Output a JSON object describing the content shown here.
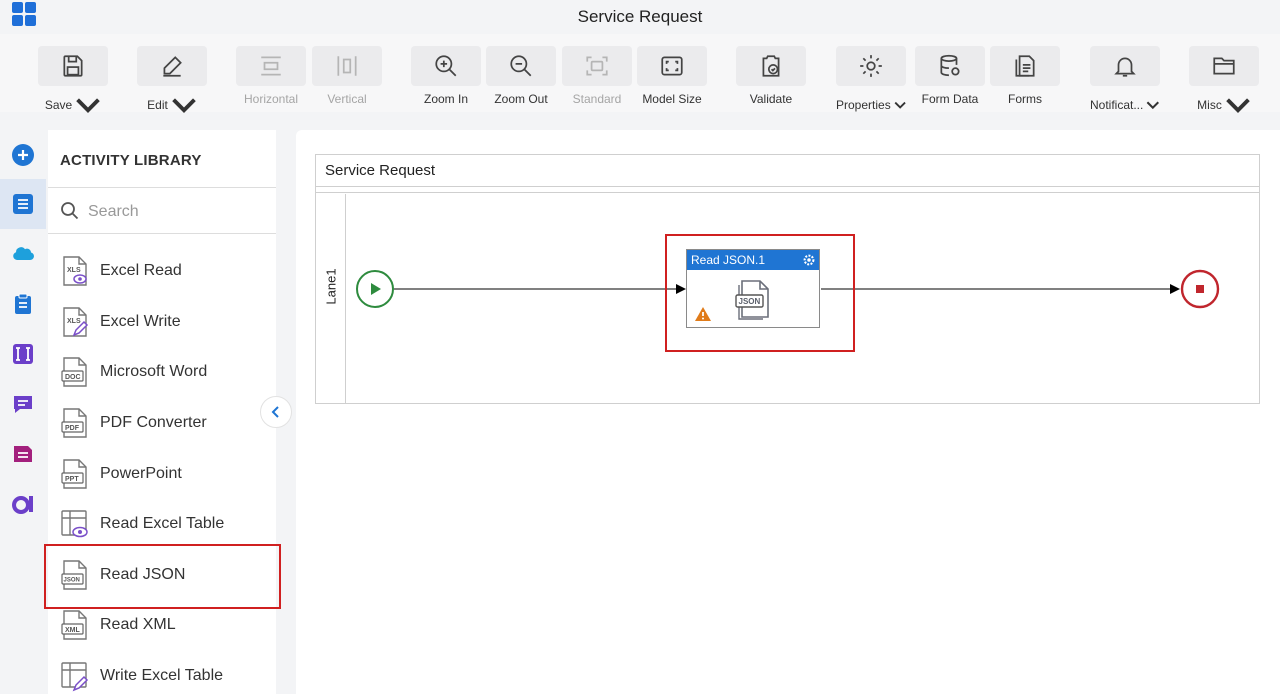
{
  "window": {
    "title": "Service Request"
  },
  "toolbar": {
    "save": "Save",
    "edit": "Edit",
    "horizontal": "Horizontal",
    "vertical": "Vertical",
    "zoom_in": "Zoom In",
    "zoom_out": "Zoom Out",
    "standard": "Standard",
    "model_size": "Model Size",
    "validate": "Validate",
    "properties": "Properties",
    "form_data": "Form Data",
    "forms": "Forms",
    "notifications": "Notificat...",
    "misc": "Misc"
  },
  "library": {
    "title": "ACTIVITY LIBRARY",
    "search_placeholder": "Search",
    "items": [
      {
        "label": "Excel Read",
        "badge": "XLS"
      },
      {
        "label": "Excel Write",
        "badge": "XLS"
      },
      {
        "label": "Microsoft Word",
        "badge": "DOC"
      },
      {
        "label": "PDF Converter",
        "badge": "PDF"
      },
      {
        "label": "PowerPoint",
        "badge": "PPT"
      },
      {
        "label": "Read Excel Table",
        "badge": ""
      },
      {
        "label": "Read JSON",
        "badge": "JSON"
      },
      {
        "label": "Read XML",
        "badge": "XML"
      },
      {
        "label": "Write Excel Table",
        "badge": ""
      }
    ]
  },
  "canvas": {
    "pool_title": "Service Request",
    "lane_label": "Lane1",
    "task": {
      "title": "Read JSON.1",
      "badge": "JSON"
    }
  },
  "colors": {
    "accent": "#1f75d3",
    "start_event": "#2e8b3e",
    "end_event": "#c0262d",
    "highlight": "#d02020",
    "warning": "#e07b1a"
  }
}
